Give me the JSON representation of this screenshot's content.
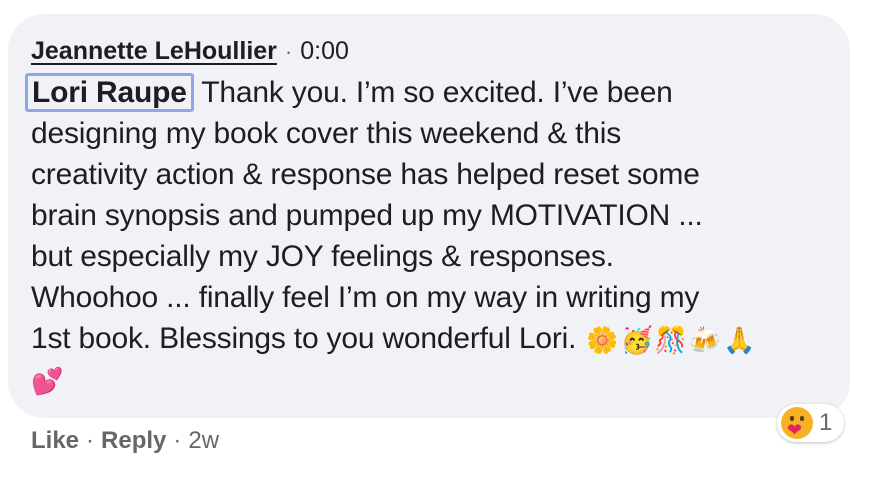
{
  "comment": {
    "author": "Jeannette LeHoullier",
    "separator": "·",
    "timestamp": "0:00",
    "mention": "Lori Raupe",
    "lines": [
      " Thank you. I’m so excited. I’ve been",
      "designing my book cover this weekend & this",
      "creativity action & response has helped reset some",
      "brain synopsis and pumped up my MOTIVATION ...",
      "but especially my JOY feelings & responses.",
      "Whoohoo ... finally feel I’m on my way in writing my",
      "1st book. Blessings to you wonderful Lori."
    ],
    "emojis": {
      "blossom": "🌼",
      "party_face": "🥳",
      "confetti": "🎊",
      "clinking": "🍻",
      "pray": "🙏",
      "hearts": "💕"
    }
  },
  "reaction": {
    "icon": "care-reaction-icon",
    "count": "1"
  },
  "actions": {
    "like": "Like",
    "dot": "·",
    "reply": "Reply",
    "age": "2w"
  },
  "colors": {
    "bubble": "#f0f2f5",
    "mention_outline": "#8aa9e6",
    "secondary_text": "#65676b"
  }
}
